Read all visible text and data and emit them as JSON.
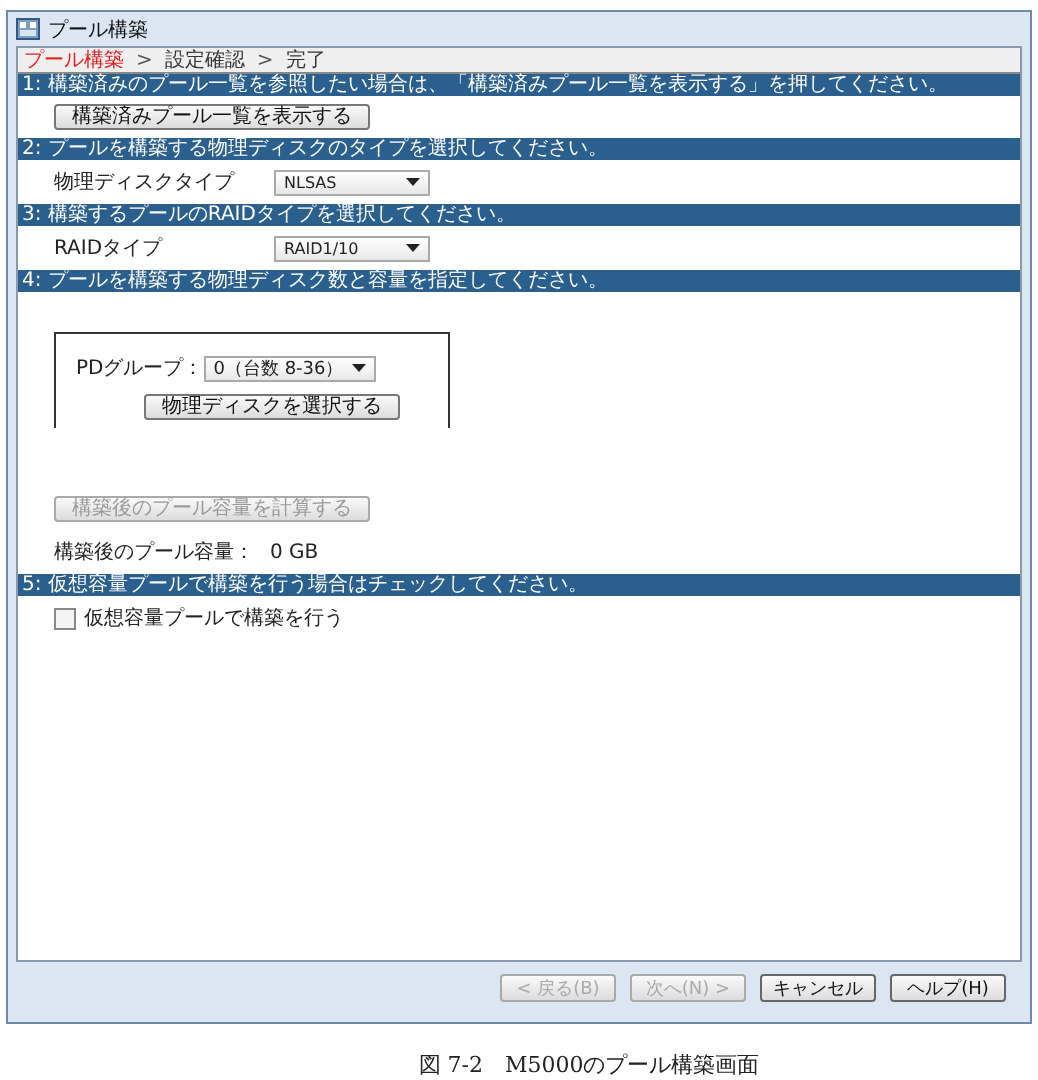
{
  "window": {
    "title": "プール構築"
  },
  "steps": [
    {
      "label": "プール構築",
      "selected": true
    },
    {
      "label": "設定確認",
      "selected": false
    },
    {
      "label": "完了",
      "selected": false
    }
  ],
  "step_separator": ">",
  "sections": [
    {
      "header": "1: 構築済みのプール一覧を参照したい場合は、「構築済みプール一覧を表示する」を押してください。",
      "items": [
        {
          "kind": "button",
          "label": "構築済みプール一覧を表示する",
          "disabled": false
        }
      ]
    },
    {
      "header": "2: プールを構築する物理ディスクのタイプを選択してください。",
      "items": [
        {
          "kind": "select",
          "label": "物理ディスクタイプ",
          "value": "NLSAS"
        }
      ]
    },
    {
      "header": "3: 構築するプールのRAIDタイプを選択してください。",
      "items": [
        {
          "kind": "select",
          "label": "RAIDタイプ",
          "value": "RAID1/10"
        }
      ]
    },
    {
      "header": "4: プールを構築する物理ディスク数と容量を指定してください。",
      "items": [
        {
          "kind": "group",
          "label": "PDグループ：",
          "value": "0（台数 8-36）",
          "button": "物理ディスクを選択する"
        },
        {
          "kind": "button",
          "label": "構築後のプール容量を計算する",
          "disabled": true
        },
        {
          "kind": "text",
          "label": "構築後のプール容量：",
          "value": "0 GB"
        }
      ]
    },
    {
      "header": "5: 仮想容量プールで構築を行う場合はチェックしてください。",
      "items": [
        {
          "kind": "checkbox",
          "label": "仮想容量プールで構築を行う",
          "checked": false
        }
      ]
    }
  ],
  "buttons": [
    {
      "label": "< 戻る(B)",
      "disabled": true
    },
    {
      "label": "次へ(N) >",
      "disabled": true
    },
    {
      "label": "キャンセル",
      "disabled": false
    },
    {
      "label": "ヘルプ(H)",
      "disabled": false
    }
  ],
  "caption": "図 7-2　M5000のプール構築画面"
}
